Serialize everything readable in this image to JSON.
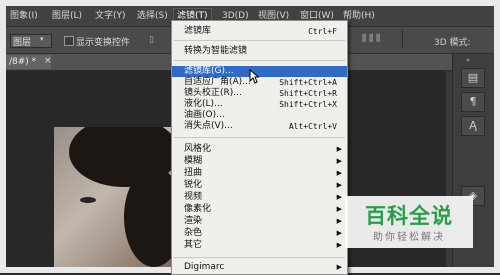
{
  "menubar": {
    "items": [
      "图象(I)",
      "图层(L)",
      "文字(Y)",
      "选择(S)",
      "滤镜(T)",
      "3D(D)",
      "视图(V)",
      "窗口(W)",
      "帮助(H)"
    ]
  },
  "options": {
    "preset_label": "图层",
    "show_transform_label": "显示变换控件",
    "mode_3d_label": "3D 模式:"
  },
  "document_tab": {
    "label": "/8#) *"
  },
  "filter_menu": {
    "last_filter": {
      "label": "滤镜库",
      "shortcut": "Ctrl+F"
    },
    "convert_smart": {
      "label": "转换为智能滤镜"
    },
    "items": [
      {
        "label": "滤镜库(G)...",
        "shortcut": ""
      },
      {
        "label": "自适应广角(A)...",
        "shortcut": "Shift+Ctrl+A"
      },
      {
        "label": "镜头校正(R)...",
        "shortcut": "Shift+Ctrl+R"
      },
      {
        "label": "液化(L)...",
        "shortcut": "Shift+Ctrl+X"
      },
      {
        "label": "油画(O)...",
        "shortcut": ""
      },
      {
        "label": "消失点(V)...",
        "shortcut": "Alt+Ctrl+V"
      }
    ],
    "submenus": [
      "风格化",
      "模糊",
      "扭曲",
      "锐化",
      "视频",
      "像素化",
      "渲染",
      "杂色",
      "其它"
    ],
    "plugin": "Digimarc"
  },
  "watermark": {
    "title": "百科全说",
    "subtitle": "助你轻松解决"
  },
  "colors": {
    "highlight": "#2f6bc4",
    "watermark_green": "#2a9d4a"
  }
}
